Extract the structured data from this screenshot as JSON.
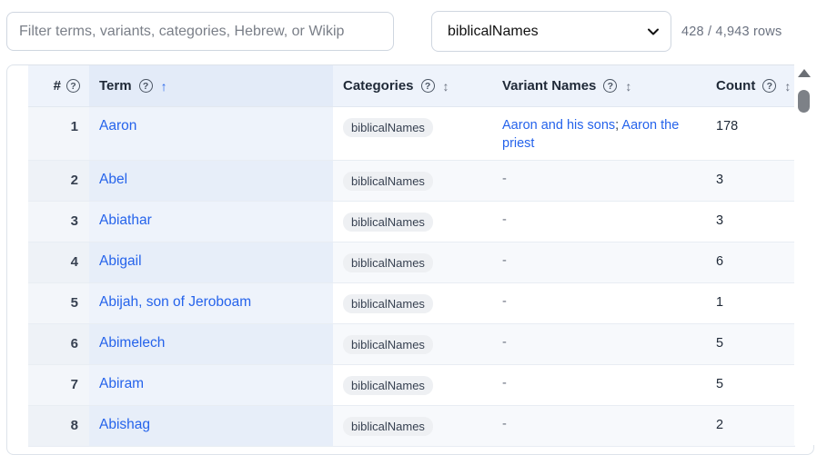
{
  "filter": {
    "placeholder": "Filter terms, variants, categories, Hebrew, or Wikip",
    "value": ""
  },
  "category_select": {
    "selected": "biblicalNames",
    "icon": "chevron-down-icon"
  },
  "row_count_text": "428 / 4,943 rows",
  "table": {
    "headers": {
      "index": "#",
      "term": "Term",
      "categories": "Categories",
      "variants": "Variant Names",
      "count": "Count"
    },
    "help_glyph": "?",
    "sort_active_glyph": "↑",
    "sort_inactive_glyph": "↕",
    "sorted_column": "term",
    "rows": [
      {
        "index": "1",
        "term": "Aaron",
        "category": "biblicalNames",
        "variants": [
          "Aaron and his sons",
          "Aaron the priest"
        ],
        "count": "178"
      },
      {
        "index": "2",
        "term": "Abel",
        "category": "biblicalNames",
        "variants": [],
        "count": "3"
      },
      {
        "index": "3",
        "term": "Abiathar",
        "category": "biblicalNames",
        "variants": [],
        "count": "3"
      },
      {
        "index": "4",
        "term": "Abigail",
        "category": "biblicalNames",
        "variants": [],
        "count": "6"
      },
      {
        "index": "5",
        "term": "Abijah, son of Jeroboam",
        "category": "biblicalNames",
        "variants": [],
        "count": "1"
      },
      {
        "index": "6",
        "term": "Abimelech",
        "category": "biblicalNames",
        "variants": [],
        "count": "5"
      },
      {
        "index": "7",
        "term": "Abiram",
        "category": "biblicalNames",
        "variants": [],
        "count": "5"
      },
      {
        "index": "8",
        "term": "Abishag",
        "category": "biblicalNames",
        "variants": [],
        "count": "2"
      }
    ],
    "empty_variant": "-"
  },
  "colors": {
    "link": "#2563eb",
    "header_bg": "#eef3fb",
    "border": "#cfd6e0"
  }
}
